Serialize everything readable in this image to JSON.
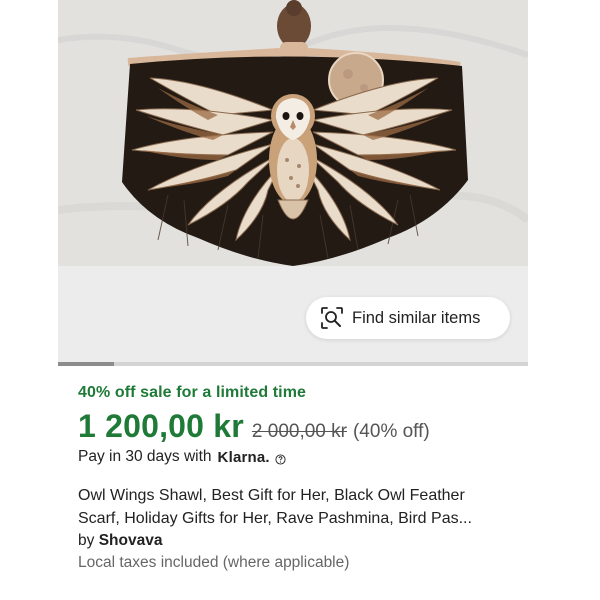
{
  "gallery": {
    "image_alt": "Owl Wings Shawl product photo",
    "find_similar_label": "Find similar items",
    "scroll_position": 0.12
  },
  "listing": {
    "sale_text": "40% off sale for a limited time",
    "price": "1 200,00 kr",
    "original_price": "2 000,00 kr",
    "discount": "(40% off)",
    "pay_prefix": "Pay in 30 days with",
    "klarna_label": "Klarna.",
    "title_line1": "Owl Wings Shawl, Best Gift for Her, Black Owl Feather",
    "title_line2": "Scarf, Holiday Gifts for Her, Rave Pashmina, Bird Pas...",
    "by_prefix": "by",
    "shop_name": "Shovava",
    "taxes_text": "Local taxes included (where applicable)"
  },
  "colors": {
    "sale_green": "#1f7a38",
    "text": "#222222",
    "muted": "#666666"
  }
}
